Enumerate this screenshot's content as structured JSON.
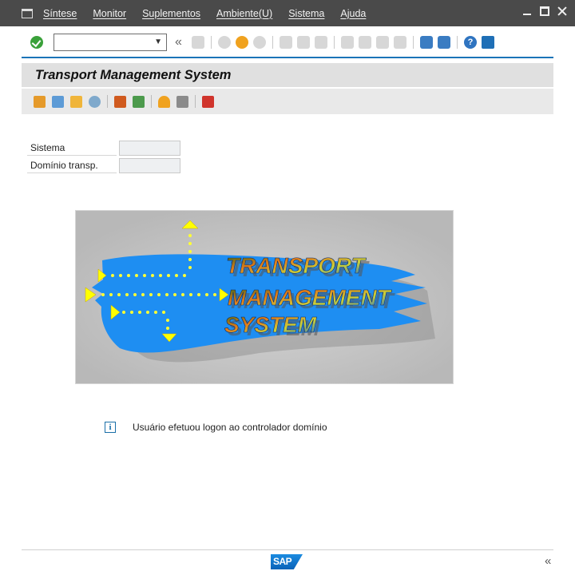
{
  "menubar": {
    "items": [
      {
        "label": "Síntese"
      },
      {
        "label": "Monitor"
      },
      {
        "label": "Suplementos"
      },
      {
        "label": "Ambiente(U)"
      },
      {
        "label": "Sistema"
      },
      {
        "label": "Ajuda"
      }
    ]
  },
  "toolbar": {
    "command_value": "",
    "icons": [
      "enter-icon",
      "command-field",
      "back-chevron-icon",
      "save-icon",
      "back-icon",
      "exit-icon",
      "cancel-icon",
      "print-icon",
      "find-icon",
      "find-next-icon",
      "first-page-icon",
      "prev-page-icon",
      "next-page-icon",
      "last-page-icon",
      "new-session-icon",
      "shortcut-icon",
      "help-icon",
      "layout-icon"
    ]
  },
  "page": {
    "title": "Transport Management System"
  },
  "form": {
    "fields": [
      {
        "label": "Sistema",
        "value": ""
      },
      {
        "label": "Domínio transp.",
        "value": ""
      }
    ]
  },
  "logo": {
    "line1": "TRANSPORT",
    "line2": "MANAGEMENT",
    "line3": "SYSTEM"
  },
  "status": {
    "icon": "info-icon",
    "message": "Usuário efetuou logon ao controlador domínio"
  },
  "footer": {
    "brand": "SAP",
    "collapse": "«"
  },
  "colors": {
    "menubar_bg": "#4a4a4a",
    "accent_blue": "#1a74b8",
    "title_bg": "#e0e0e0",
    "logo_blue": "#1e8ef2",
    "arrow_yellow": "#ffff00"
  }
}
